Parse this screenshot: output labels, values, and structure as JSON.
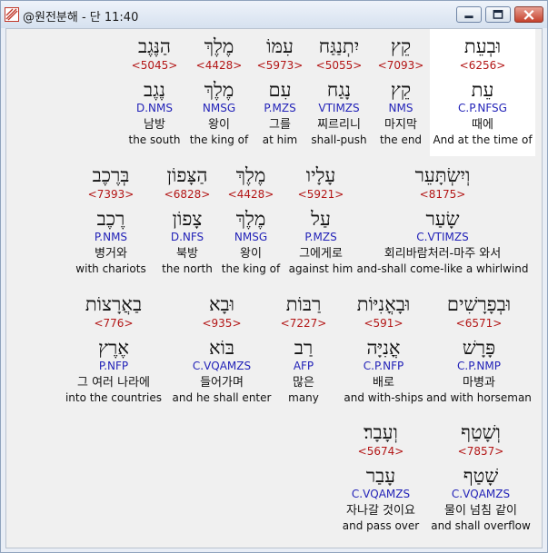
{
  "window": {
    "title": "@원전분해 - 단 11:40"
  },
  "rows": [
    [
      {
        "heb": "וּבְעֵת",
        "strong": "<6256>",
        "lemma": "עֵת",
        "morph": "C.P.NFSG",
        "kor": "때에",
        "eng": "And at the time of"
      },
      {
        "heb": "קֵץ",
        "strong": "<7093>",
        "lemma": "קֵץ",
        "morph": "NMS",
        "kor": "마지막",
        "eng": "the end"
      },
      {
        "heb": "יִתְנַגַּח",
        "strong": "<5055>",
        "lemma": "נָגַח",
        "morph": "VTIMZS",
        "kor": "찌르리니",
        "eng": "shall-push"
      },
      {
        "heb": "עִמּוֹ",
        "strong": "<5973>",
        "lemma": "עִם",
        "morph": "P.MZS",
        "kor": "그를",
        "eng": "at him"
      },
      {
        "heb": "מֶלֶךְ",
        "strong": "<4428>",
        "lemma": "מֶלֶךְ",
        "morph": "NMSG",
        "kor": "왕이",
        "eng": "the king of"
      },
      {
        "heb": "הַנֶּגֶב",
        "strong": "<5045>",
        "lemma": "נֶגֶב",
        "morph": "D.NMS",
        "kor": "남방",
        "eng": "the south"
      }
    ],
    [
      {
        "heb": "וְיִשְׂתָּעֵר",
        "strong": "<8175>",
        "lemma": "שָׂעַר",
        "morph": "C.VTIMZS",
        "kor": "회리바람처러-마주 와서",
        "eng": "and-shall come-like a whirlwind"
      },
      {
        "heb": "עָלָיו",
        "strong": "<5921>",
        "lemma": "עַל",
        "morph": "P.MZS",
        "kor": "그에게로",
        "eng": "against him"
      },
      {
        "heb": "מֶלֶךְ",
        "strong": "<4428>",
        "lemma": "מֶלֶךְ",
        "morph": "NMSG",
        "kor": "왕이",
        "eng": "the king of"
      },
      {
        "heb": "הַצָּפוֹן",
        "strong": "<6828>",
        "lemma": "צָפוֹן",
        "morph": "D.NFS",
        "kor": "북방",
        "eng": "the north"
      },
      {
        "heb": "בְּרֶכֶב",
        "strong": "<7393>",
        "lemma": "רֶכֶב",
        "morph": "P.NMS",
        "kor": "병거와",
        "eng": "with chariots"
      }
    ],
    [
      {
        "heb": "וּבְפָרָשִׁים",
        "strong": "<6571>",
        "lemma": "פָּרָשׁ",
        "morph": "C.P.NMP",
        "kor": "마병과",
        "eng": "and with horseman"
      },
      {
        "heb": "וּבָאֳנִיּוֹת",
        "strong": "<591>",
        "lemma": "אֳנִיָּה",
        "morph": "C.P.NFP",
        "kor": "배로",
        "eng": "and with-ships"
      },
      {
        "heb": "רַבּוֹת",
        "strong": "<7227>",
        "lemma": "רַב",
        "morph": "AFP",
        "kor": "많은",
        "eng": "many"
      },
      {
        "heb": "וּבָא",
        "strong": "<935>",
        "lemma": "בּוֹא",
        "morph": "C.VQAMZS",
        "kor": "들어가며",
        "eng": "and he shall enter"
      },
      {
        "heb": "בַאֲרָצוֹת",
        "strong": "<776>",
        "lemma": "אֶרֶץ",
        "morph": "P.NFP",
        "kor": "그 여러 나라에",
        "eng": "into the countries"
      }
    ],
    [
      {
        "heb": "וְשָׁטַף",
        "strong": "<7857>",
        "lemma": "שָׁטַף",
        "morph": "C.VQAMZS",
        "kor": "물이 넘침 같이",
        "eng": "and shall overflow"
      },
      {
        "heb": "וְעָבָר׃",
        "strong": "<5674>",
        "lemma": "עָבַר",
        "morph": "C.VQAMZS",
        "kor": "자나갈 것이요",
        "eng": "and pass over"
      }
    ]
  ]
}
